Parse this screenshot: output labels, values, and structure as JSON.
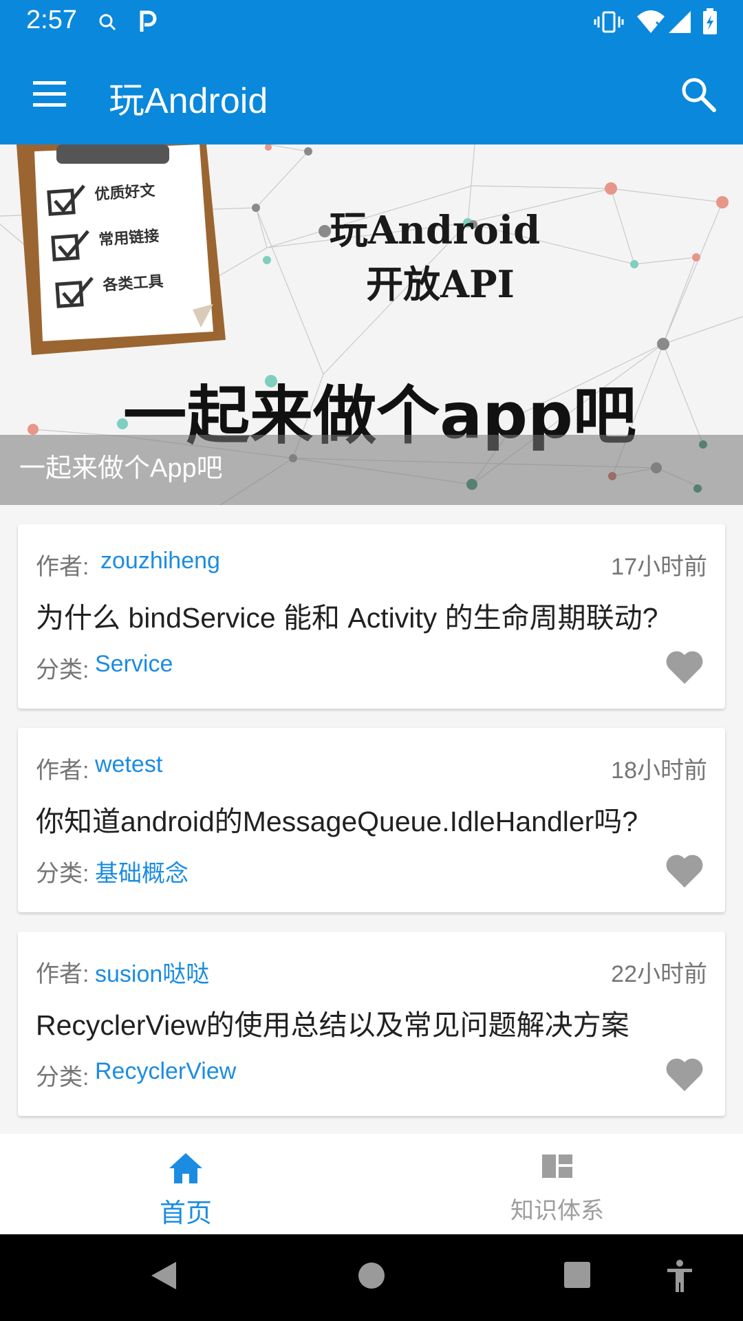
{
  "status_bar": {
    "time": "2:57"
  },
  "app_bar": {
    "title": "玩Android",
    "menu_icon": "menu-icon",
    "search_icon": "search-icon"
  },
  "banner": {
    "line1": "玩Android",
    "line2": "开放API",
    "slogan": "一起来做个app吧",
    "checklist": [
      "优质好文",
      "常用链接",
      "各类工具"
    ],
    "caption": "一起来做个App吧"
  },
  "articles": [
    {
      "author_label": "作者:",
      "author": "zouzhiheng",
      "time": "17小时前",
      "title": "为什么 bindService 能和 Activity 的生命周期联动?",
      "category_label": "分类:",
      "category": "Service"
    },
    {
      "author_label": "作者:",
      "author": "wetest",
      "time": "18小时前",
      "title": "你知道android的MessageQueue.IdleHandler吗?",
      "category_label": "分类:",
      "category": "基础概念"
    },
    {
      "author_label": "作者:",
      "author": "susion哒哒",
      "time": "22小时前",
      "title": "RecyclerView的使用总结以及常见问题解决方案",
      "category_label": "分类:",
      "category": "RecyclerView"
    }
  ],
  "bottom_nav": [
    {
      "label": "首页",
      "icon": "home-icon",
      "active": true
    },
    {
      "label": "知识体系",
      "icon": "dashboard-icon",
      "active": false
    }
  ],
  "colors": {
    "primary": "#0a88dc",
    "link": "#1b8ce2",
    "inactive": "#9e9e9e",
    "heart": "#9e9e9e"
  }
}
